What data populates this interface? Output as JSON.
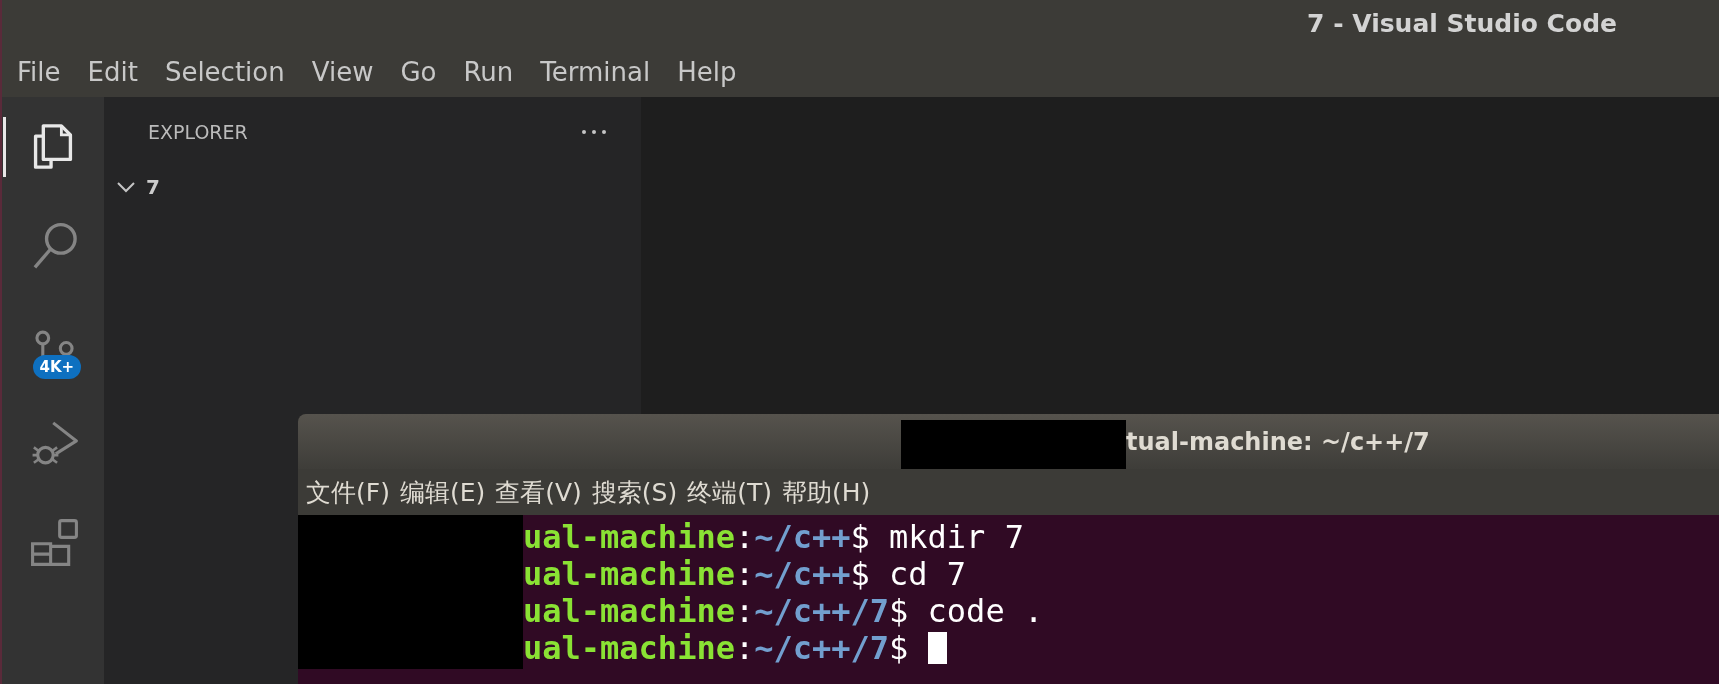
{
  "window": {
    "title": "7 - Visual Studio Code"
  },
  "menu": [
    "File",
    "Edit",
    "Selection",
    "View",
    "Go",
    "Run",
    "Terminal",
    "Help"
  ],
  "activity_bar": [
    {
      "kind": "explorer",
      "selected": true
    },
    {
      "kind": "search",
      "selected": false
    },
    {
      "kind": "source-control",
      "selected": false,
      "badge": "4K+"
    },
    {
      "kind": "run",
      "selected": false
    },
    {
      "kind": "extensions",
      "selected": false
    }
  ],
  "sidebar": {
    "title": "EXPLORER",
    "tree": [
      {
        "label": "7",
        "expanded": true
      }
    ]
  },
  "terminal": {
    "title": "tual-machine: ~/c++/7",
    "menu": [
      "文件(F)",
      "编辑(E)",
      "查看(V)",
      "搜索(S)",
      "终端(T)",
      "帮助(H)"
    ],
    "lines": [
      {
        "user": "ual-machine",
        "sep": ":",
        "path": "~/c++",
        "rest": "$ mkdir 7",
        "cursor": false
      },
      {
        "user": "ual-machine",
        "sep": ":",
        "path": "~/c++",
        "rest": "$ cd 7",
        "cursor": false
      },
      {
        "user": "ual-machine",
        "sep": ":",
        "path": "~/c++/7",
        "rest": "$ code .",
        "cursor": false
      },
      {
        "user": "ual-machine",
        "sep": ":",
        "path": "~/c++/7",
        "rest": "$ ",
        "cursor": true
      }
    ]
  }
}
